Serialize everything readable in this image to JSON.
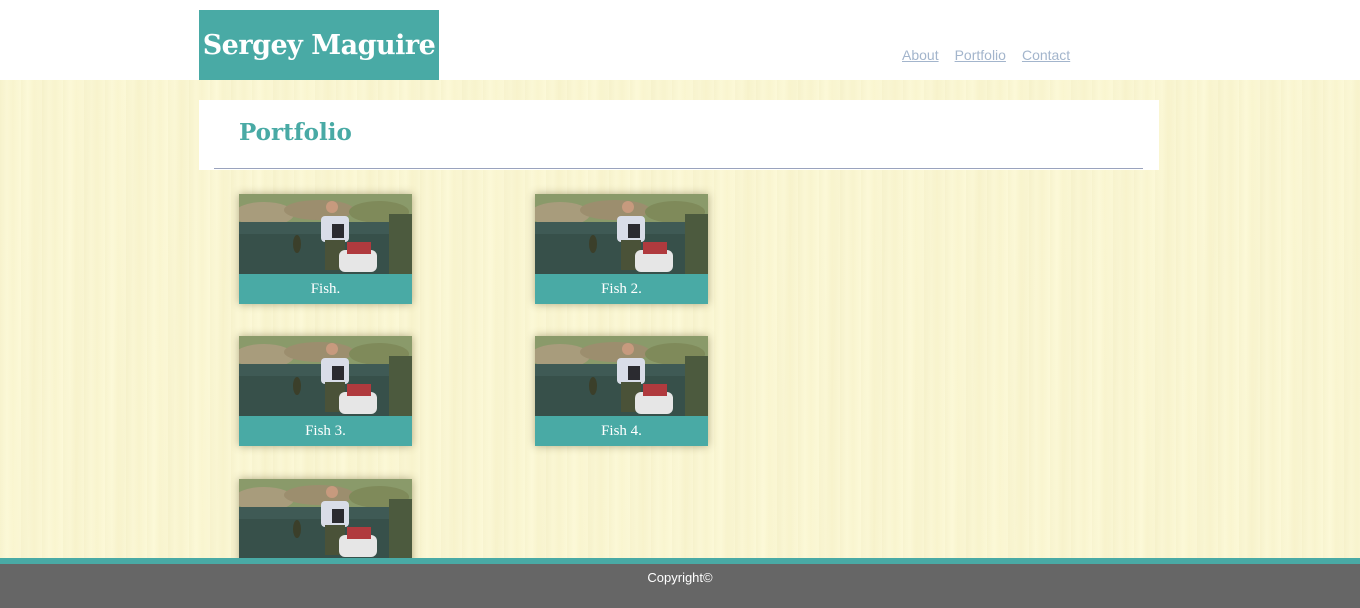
{
  "header": {
    "logo_text": "Sergey Maguire",
    "nav": [
      "About",
      "Portfolio",
      "Contact"
    ]
  },
  "main": {
    "title": "Portfolio",
    "items": [
      {
        "caption": "Fish."
      },
      {
        "caption": "Fish 2."
      },
      {
        "caption": "Fish 3."
      },
      {
        "caption": "Fish 4."
      },
      {
        "caption": ""
      }
    ]
  },
  "footer": {
    "copyright": "Copyright©"
  },
  "colors": {
    "accent": "#49aaa5",
    "background": "#fcf9d8",
    "footer": "#666666",
    "nav_link": "#a3b5cc"
  }
}
